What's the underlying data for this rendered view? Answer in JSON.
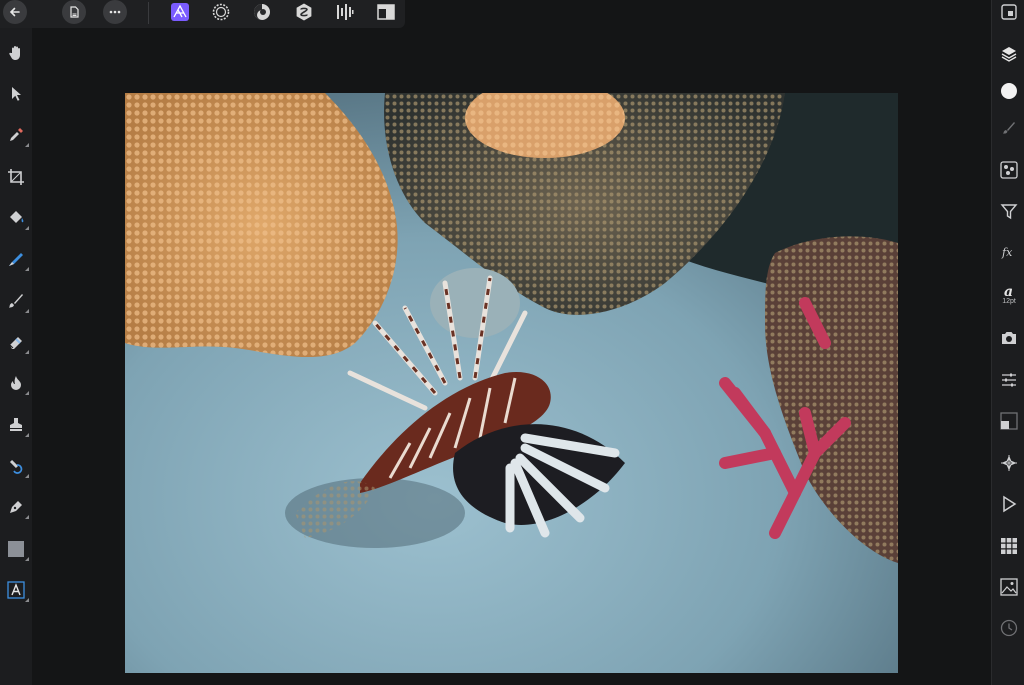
{
  "top_toolbar": {
    "personas": [
      "photo-persona",
      "liquify-persona",
      "develop-persona",
      "tone-mapping-persona",
      "export-persona"
    ],
    "active_persona": "photo-persona",
    "accent_color": "#7b5cff"
  },
  "left_tools": [
    "hand",
    "move",
    "color-picker",
    "crop",
    "flood-fill",
    "selection-brush",
    "paint-brush",
    "eraser",
    "dodge-burn",
    "clone",
    "healing",
    "pen",
    "shape",
    "text"
  ],
  "right_studios": {
    "character_size": "12pt"
  },
  "document": {
    "subject": "lionfish-coral-photo"
  }
}
